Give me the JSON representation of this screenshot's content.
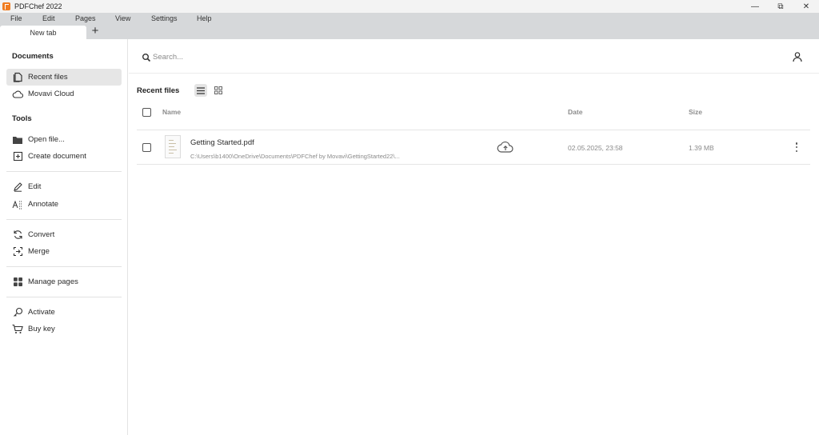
{
  "window": {
    "title": "PDFChef 2022",
    "controls": {
      "minimize": "—",
      "restore": "⧉",
      "close": "✕"
    }
  },
  "menu": [
    "File",
    "Edit",
    "Pages",
    "View",
    "Settings",
    "Help"
  ],
  "tabs": [
    {
      "label": "New tab"
    }
  ],
  "tab_add_label": "+",
  "sidebar": {
    "documents_heading": "Documents",
    "documents": [
      {
        "label": "Recent files",
        "icon": "file-icon",
        "active": true
      },
      {
        "label": "Movavi Cloud",
        "icon": "cloud-icon"
      }
    ],
    "tools_heading": "Tools",
    "tools": [
      {
        "label": "Open file...",
        "icon": "folder-icon"
      },
      {
        "label": "Create document",
        "icon": "add-document-icon"
      },
      {
        "label": "Edit",
        "icon": "pencil-icon"
      },
      {
        "label": "Annotate",
        "icon": "annotate-icon"
      },
      {
        "label": "Convert",
        "icon": "convert-icon"
      },
      {
        "label": "Merge",
        "icon": "merge-icon"
      },
      {
        "label": "Manage pages",
        "icon": "grid-icon"
      },
      {
        "label": "Activate",
        "icon": "key-icon"
      },
      {
        "label": "Buy key",
        "icon": "cart-icon"
      }
    ]
  },
  "search": {
    "placeholder": "Search...",
    "value": ""
  },
  "recent": {
    "title": "Recent files",
    "columns": {
      "name": "Name",
      "date": "Date",
      "size": "Size"
    },
    "files": [
      {
        "name": "Getting Started.pdf",
        "path": "C:\\Users\\b1400\\OneDrive\\Documents\\PDFChef by Movavi\\GettingStarted22\\...",
        "date": "02.05.2025, 23:58",
        "size": "1.39 MB"
      }
    ]
  },
  "colors": {
    "accent": "#f07d22",
    "menubar": "#d6d8da",
    "active_item": "#e6e6e6"
  }
}
